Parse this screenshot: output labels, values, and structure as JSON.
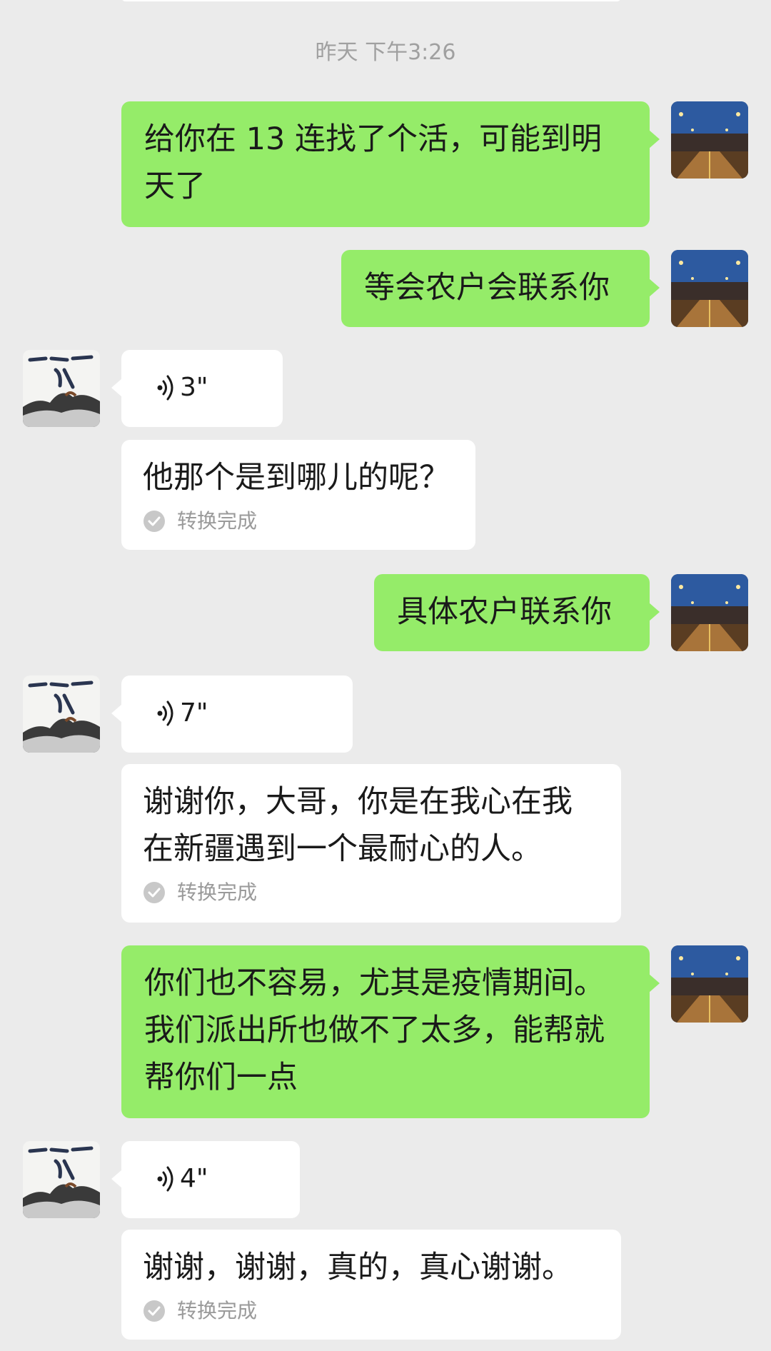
{
  "timestamp": "昨天 下午3:26",
  "messages": {
    "m1": {
      "text": "给你在 13 连找了个活，可能到明天了"
    },
    "m2": {
      "text": "等会农户会联系你"
    },
    "m3": {
      "duration": "3\""
    },
    "m4": {
      "text": "他那个是到哪儿的呢？",
      "status": "转换完成"
    },
    "m5": {
      "text": "具体农户联系你"
    },
    "m6": {
      "duration": "7\""
    },
    "m7": {
      "text": "谢谢你，大哥，你是在我心在我在新疆遇到一个最耐心的人。",
      "status": "转换完成"
    },
    "m8": {
      "text": "你们也不容易，尤其是疫情期间。我们派出所也做不了太多，能帮就帮你们一点"
    },
    "m9": {
      "duration": "4\""
    },
    "m10": {
      "text": "谢谢，谢谢，真的，真心谢谢。",
      "status": "转换完成"
    }
  },
  "colors": {
    "background": "#ebebeb",
    "sent_bubble": "#95ec69",
    "received_bubble": "#ffffff",
    "meta_text": "#a0a0a0"
  },
  "icons": {
    "voice": "voice-wave-icon",
    "transcription_done": "check-circle-icon"
  }
}
